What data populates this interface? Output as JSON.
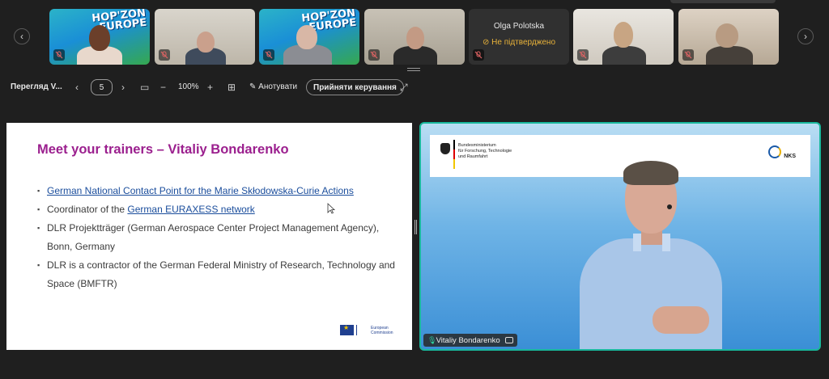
{
  "gallery": {
    "tiles": [
      {
        "kind": "video",
        "muted": true,
        "background_text": "HOP'ZON EUROPE"
      },
      {
        "kind": "video",
        "muted": true
      },
      {
        "kind": "video",
        "muted": true,
        "background_text": "HOP'ZON EUROPE"
      },
      {
        "kind": "video",
        "muted": true
      },
      {
        "kind": "placeholder",
        "name": "Olga Polotska",
        "status": "Не підтверджено",
        "muted": true
      },
      {
        "kind": "video",
        "muted": true
      },
      {
        "kind": "video",
        "muted": true
      }
    ]
  },
  "toolbar": {
    "view_label": "Перегляд V...",
    "page_number": "5",
    "zoom": "100%",
    "annotate_label": "Анотувати",
    "take_control_label": "Прийняти керування"
  },
  "slide": {
    "title": "Meet your trainers – Vitaliy Bondarenko",
    "bullets": {
      "b1_link": "German National Contact Point for the Marie Skłodowska-Curie Actions",
      "b2_text": "Coordinator of the ",
      "b2_link": "German EURAXESS network",
      "b3_text": "DLR Projektträger (German Aerospace Center Project Management Agency), Bonn, Germany",
      "b4_text": "DLR is a contractor of the German Federal Ministry of Research, Technology and Space (BMFTR)"
    },
    "footer_logo": {
      "line1": "European",
      "line2": "Commission"
    }
  },
  "speaker": {
    "name": "Vitaliy Bondarenko",
    "banner": {
      "ministry_line1": "Bundesministerium",
      "ministry_line2": "für Forschung, Technologie",
      "ministry_line3": "und Raumfahrt",
      "right_logo": "NKS"
    }
  },
  "colors": {
    "slide_title": "#9b1f8e",
    "link": "#1a4d9c",
    "active_speaker_border": "#19b89c",
    "status_unconfirmed": "#e8b23a"
  }
}
